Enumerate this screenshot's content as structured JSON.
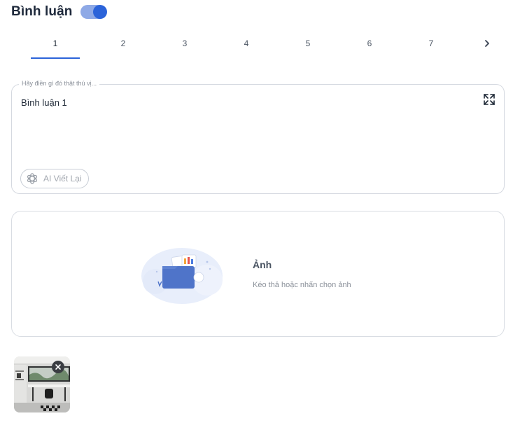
{
  "header": {
    "title": "Bình luận",
    "toggle_on": true
  },
  "tabs": {
    "items": [
      {
        "label": "1",
        "active": true
      },
      {
        "label": "2",
        "active": false
      },
      {
        "label": "3",
        "active": false
      },
      {
        "label": "4",
        "active": false
      },
      {
        "label": "5",
        "active": false
      },
      {
        "label": "6",
        "active": false
      },
      {
        "label": "7",
        "active": false
      }
    ],
    "next_icon": "chevron-right-icon"
  },
  "comment": {
    "placeholder": "Hãy điền gì đó thật thú vị...",
    "value": "Bình luận 1",
    "expand_icon": "expand-icon",
    "ai_button_label": "AI Viết Lại",
    "ai_icon": "openai-icon"
  },
  "upload": {
    "title": "Ảnh",
    "subtitle": "Kéo thả hoặc nhấn chọn ảnh",
    "illustration_icon": "folder-upload-illustration"
  },
  "attachments": [
    {
      "name": "office-room-photo",
      "close_icon": "close-icon"
    }
  ],
  "colors": {
    "accent": "#2b63d9",
    "toggle_track": "#8ea9e6",
    "border": "#d5d9e0"
  }
}
